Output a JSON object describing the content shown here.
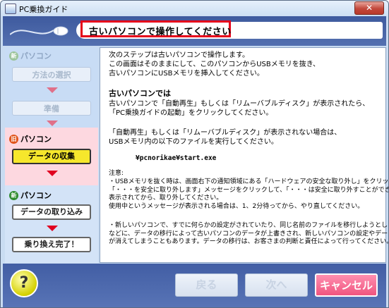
{
  "window": {
    "title": "PC乗換ガイド",
    "close_label": "✕"
  },
  "banner": {
    "heading": "古いパソコンで操作してください"
  },
  "sidebar": {
    "new_pc_label_1": "パソコン",
    "new_badge": "新",
    "old_badge": "旧",
    "old_pc_label": "パソコン",
    "new_pc_label_2": "パソコン",
    "steps": [
      {
        "label": "方法の選択",
        "state": "done"
      },
      {
        "label": "準備",
        "state": "done"
      },
      {
        "label": "データの収集",
        "state": "current"
      },
      {
        "label": "データの取り込み",
        "state": "pending"
      },
      {
        "label": "乗り換え完了！",
        "state": "pending"
      }
    ]
  },
  "content": {
    "intro": "次のステップは古いパソコンで操作します。\nこの画面はそのままにして、このパソコンからUSBメモリを抜き、\n古いパソコンにUSBメモリを挿入してください。",
    "sub_heading": "古いパソコンでは",
    "instruction_1": "古いパソコンで「自動再生」もしくは「リムーバブルディスク」が表示されたら、\n「PC乗換ガイドの起動」をクリックしてください。",
    "instruction_2": "「自動再生」もしくは「リムーバブルディスク」が表示されない場合は、\nUSBメモリ内の以下のファイルを実行してください。",
    "command": "¥pcnorikae¥start.exe",
    "note_title": "注意:",
    "note_1": "・USBメモリを抜く時は、画面右下の通知領域にある「ハードウェアの安全な取り外し」をクリックし、\n「・・・を安全に取り外します」メッセージをクリックして、「・・・は安全に取り外すことができます。」が\n表示されてから、取り外してください。\n使用中というメッセージが表示される場合は、1、2分待ってから、やり直してください。",
    "note_2": "・新しいパソコンで、すでに何らかの設定がされていたり、同じ名前のファイルを移行しようとした場合\nなどに、データの移行によって古いパソコンのデータが上書きされ、新しいパソコンの設定やデータ\nが消えてしまうこともあります。データの移行は、お客さまの判断と責任によって行ってください。"
  },
  "footer": {
    "help_label": "?",
    "back_label": "戻る",
    "next_label": "次へ",
    "cancel_label": "キャンセル"
  }
}
